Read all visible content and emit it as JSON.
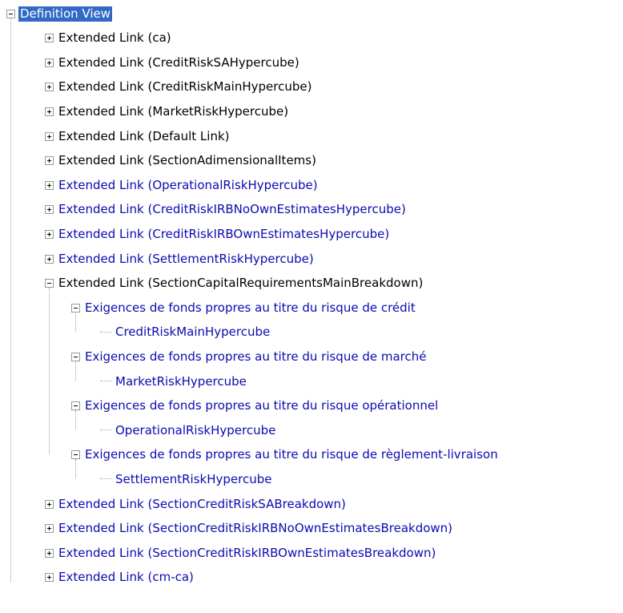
{
  "tree": {
    "root": {
      "label": "Definition View",
      "expanded": true,
      "selected": true
    },
    "items": [
      {
        "label": "Extended Link (ca)",
        "level": 1,
        "kind": "expandable",
        "expanded": false,
        "color": "black"
      },
      {
        "label": "Extended Link (CreditRiskSAHypercube)",
        "level": 1,
        "kind": "expandable",
        "expanded": false,
        "color": "black"
      },
      {
        "label": "Extended Link (CreditRiskMainHypercube)",
        "level": 1,
        "kind": "expandable",
        "expanded": false,
        "color": "black"
      },
      {
        "label": "Extended Link (MarketRiskHypercube)",
        "level": 1,
        "kind": "expandable",
        "expanded": false,
        "color": "black"
      },
      {
        "label": "Extended Link (Default Link)",
        "level": 1,
        "kind": "expandable",
        "expanded": false,
        "color": "black"
      },
      {
        "label": "Extended Link (SectionAdimensionalItems)",
        "level": 1,
        "kind": "expandable",
        "expanded": false,
        "color": "black"
      },
      {
        "label": "Extended Link (OperationalRiskHypercube)",
        "level": 1,
        "kind": "expandable",
        "expanded": false,
        "color": "blue"
      },
      {
        "label": "Extended Link (CreditRiskIRBNoOwnEstimatesHypercube)",
        "level": 1,
        "kind": "expandable",
        "expanded": false,
        "color": "blue"
      },
      {
        "label": "Extended Link (CreditRiskIRBOwnEstimatesHypercube)",
        "level": 1,
        "kind": "expandable",
        "expanded": false,
        "color": "blue"
      },
      {
        "label": "Extended Link (SettlementRiskHypercube)",
        "level": 1,
        "kind": "expandable",
        "expanded": false,
        "color": "blue"
      },
      {
        "label": "Extended Link (SectionCapitalRequirementsMainBreakdown)",
        "level": 1,
        "kind": "expandable",
        "expanded": true,
        "color": "black"
      },
      {
        "label": "Exigences de fonds propres au titre du risque de crédit",
        "level": 2,
        "kind": "expandable",
        "expanded": true,
        "color": "blue"
      },
      {
        "label": "CreditRiskMainHypercube",
        "level": 3,
        "kind": "leaf",
        "color": "blue"
      },
      {
        "label": "Exigences de fonds propres au titre du risque de marché",
        "level": 2,
        "kind": "expandable",
        "expanded": true,
        "color": "blue"
      },
      {
        "label": "MarketRiskHypercube",
        "level": 3,
        "kind": "leaf",
        "color": "blue"
      },
      {
        "label": "Exigences de fonds propres au titre du risque opérationnel",
        "level": 2,
        "kind": "expandable",
        "expanded": true,
        "color": "blue"
      },
      {
        "label": "OperationalRiskHypercube",
        "level": 3,
        "kind": "leaf",
        "color": "blue"
      },
      {
        "label": "Exigences de fonds propres au titre du risque de règlement-livraison",
        "level": 2,
        "kind": "expandable",
        "expanded": true,
        "color": "blue"
      },
      {
        "label": "SettlementRiskHypercube",
        "level": 3,
        "kind": "leaf",
        "color": "blue"
      },
      {
        "label": "Extended Link (SectionCreditRiskSABreakdown)",
        "level": 1,
        "kind": "expandable",
        "expanded": false,
        "color": "blue"
      },
      {
        "label": "Extended Link (SectionCreditRiskIRBNoOwnEstimatesBreakdown)",
        "level": 1,
        "kind": "expandable",
        "expanded": false,
        "color": "blue"
      },
      {
        "label": "Extended Link (SectionCreditRiskIRBOwnEstimatesBreakdown)",
        "level": 1,
        "kind": "expandable",
        "expanded": false,
        "color": "blue"
      },
      {
        "label": "Extended Link (cm-ca)",
        "level": 1,
        "kind": "expandable",
        "expanded": false,
        "color": "blue"
      }
    ]
  }
}
